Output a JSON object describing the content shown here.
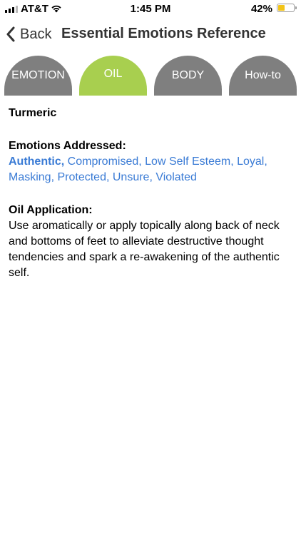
{
  "status_bar": {
    "carrier": "AT&T",
    "time": "1:45 PM",
    "battery_percent": "42%",
    "battery_level": 0.42,
    "battery_color": "#f2c419"
  },
  "nav": {
    "back_label": "Back",
    "title": "Essential Emotions Reference"
  },
  "tabs": [
    {
      "label": "EMOTION",
      "active": false
    },
    {
      "label": "OIL",
      "active": true
    },
    {
      "label": "BODY",
      "active": false
    },
    {
      "label": "How-to",
      "active": false
    }
  ],
  "colors": {
    "tab_inactive": "#7f7f7f",
    "tab_active": "#a8cf4f",
    "link": "#3a7bd5"
  },
  "oil": {
    "name": "Turmeric",
    "emotions_heading": "Emotions Addressed:",
    "emotions": [
      "Authentic,",
      "Compromised,",
      "Low Self Esteem,",
      "Loyal,",
      "Masking,",
      "Protected,",
      "Unsure,",
      "Violated"
    ],
    "application_heading": "Oil Application:",
    "application_text": "Use aromatically or apply topically along back of neck and bottoms of feet to alleviate destructive thought tendencies and spark a re-awakening of the authentic self."
  },
  "icons": {
    "back": "chevron-left-icon",
    "wifi": "wifi-icon",
    "signal": "signal-bars-icon",
    "battery": "battery-icon"
  }
}
